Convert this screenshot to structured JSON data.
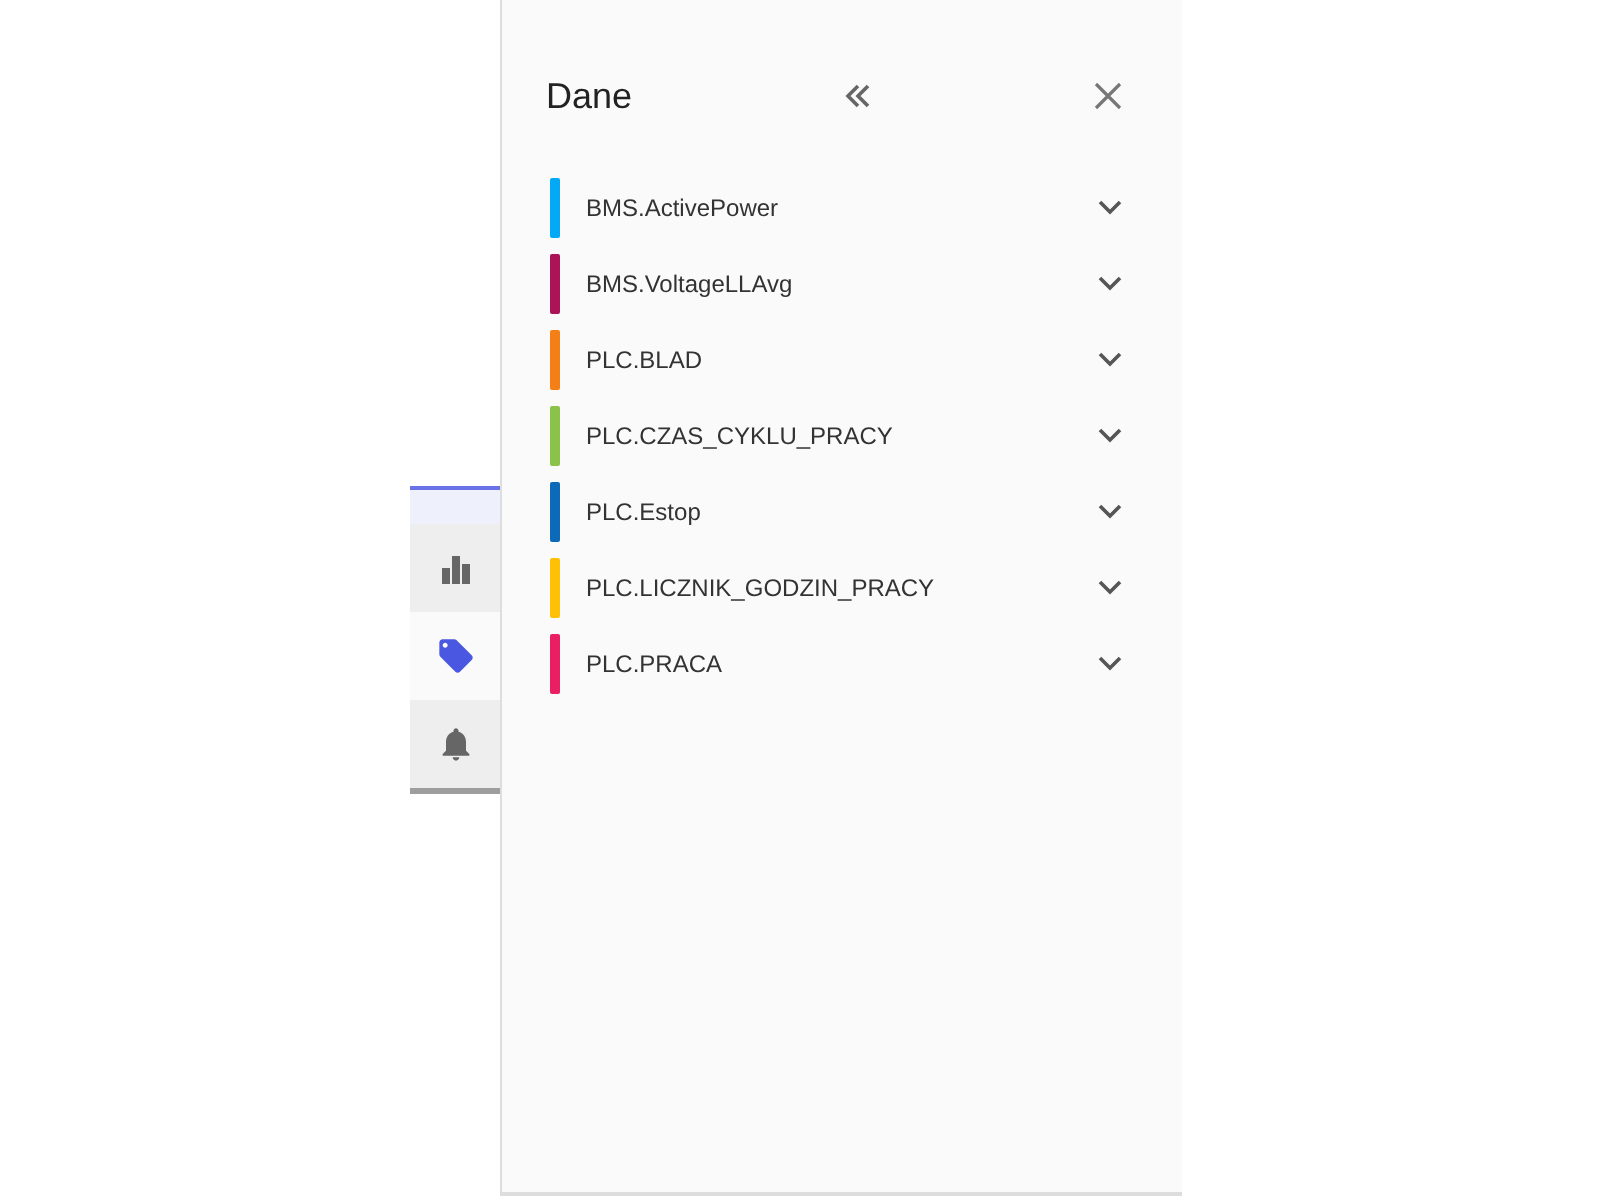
{
  "side_tabs": [
    {
      "kind": "chart",
      "selected": false
    },
    {
      "kind": "tag",
      "selected": true
    },
    {
      "kind": "bell",
      "selected": false
    }
  ],
  "panel": {
    "title": "Dane",
    "items": [
      {
        "name": "BMS.ActivePower",
        "color": "#03a9f4",
        "expanded": false
      },
      {
        "name": "BMS.VoltageLLAvg",
        "color": "#ad1457",
        "expanded": false
      },
      {
        "name": "PLC.BLAD",
        "color": "#f57f17",
        "expanded": false
      },
      {
        "name": "PLC.CZAS_CYKLU_PRACY",
        "color": "#8bc34a",
        "expanded": false
      },
      {
        "name": "PLC.Estop",
        "color": "#0d6ab8",
        "expanded": false
      },
      {
        "name": "PLC.LICZNIK_GODZIN_PRACY",
        "color": "#ffc107",
        "expanded": false
      },
      {
        "name": "PLC.PRACA",
        "color": "#e91e63",
        "expanded": false
      }
    ]
  }
}
